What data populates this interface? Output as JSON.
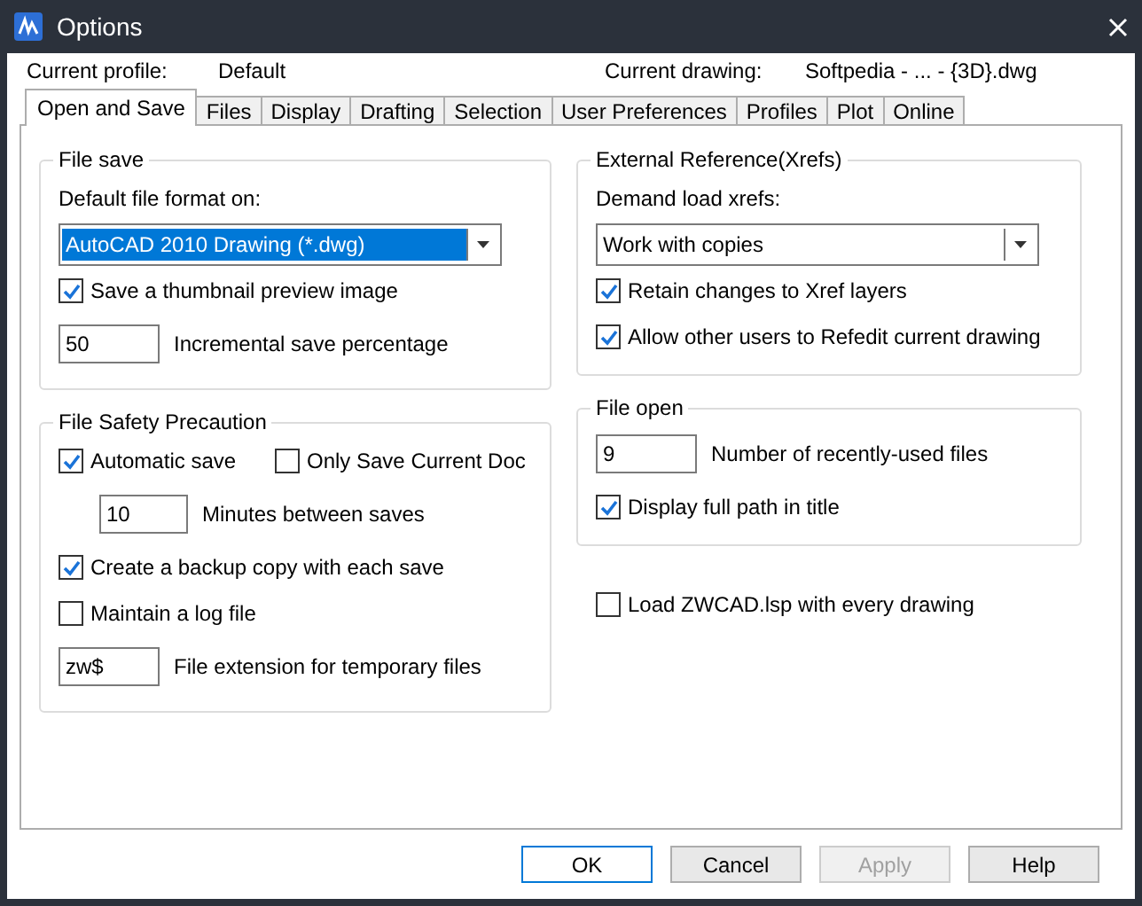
{
  "window": {
    "title": "Options"
  },
  "profile": {
    "label": "Current profile:",
    "value": "Default"
  },
  "drawing": {
    "label": "Current drawing:",
    "value": "Softpedia - ... - {3D}.dwg"
  },
  "tabs": [
    {
      "label": "Open and Save",
      "selected": true
    },
    {
      "label": "Files",
      "selected": false
    },
    {
      "label": "Display",
      "selected": false
    },
    {
      "label": "Drafting",
      "selected": false
    },
    {
      "label": "Selection",
      "selected": false
    },
    {
      "label": "User Preferences",
      "selected": false
    },
    {
      "label": "Profiles",
      "selected": false
    },
    {
      "label": "Plot",
      "selected": false
    },
    {
      "label": "Online",
      "selected": false
    }
  ],
  "columns": [
    {
      "groups": [
        {
          "title": "File save",
          "items": [
            {
              "kind": "label",
              "text": "Default file format on:"
            },
            {
              "kind": "dropdown",
              "value": "AutoCAD 2010 Drawing (*.dwg)",
              "focused": true
            },
            {
              "kind": "checkbox",
              "label": "Save a thumbnail preview image",
              "checked": true
            },
            {
              "kind": "number",
              "value": "50",
              "caption": "Incremental save percentage"
            }
          ]
        },
        {
          "title": "File Safety Precaution",
          "items": [
            {
              "kind": "checkbox_row",
              "boxes": [
                {
                  "label": "Automatic save",
                  "checked": true
                },
                {
                  "label": "Only Save Current Doc",
                  "checked": false
                }
              ]
            },
            {
              "kind": "number",
              "indent": true,
              "value": "10",
              "caption": "Minutes between saves"
            },
            {
              "kind": "checkbox",
              "label": "Create a backup copy with each save",
              "checked": true
            },
            {
              "kind": "checkbox",
              "label": "Maintain a log file",
              "checked": false
            },
            {
              "kind": "number",
              "value": "zw$",
              "caption": "File extension for temporary files"
            }
          ]
        }
      ]
    },
    {
      "groups": [
        {
          "title": "External Reference(Xrefs)",
          "items": [
            {
              "kind": "label",
              "text": "Demand load xrefs:"
            },
            {
              "kind": "dropdown",
              "value": "Work with copies",
              "focused": false
            },
            {
              "kind": "checkbox",
              "label": "Retain changes to Xref layers",
              "checked": true
            },
            {
              "kind": "checkbox",
              "label": "Allow other users to Refedit current drawing",
              "checked": true
            }
          ]
        },
        {
          "title": "File open",
          "items": [
            {
              "kind": "number",
              "value": "9",
              "caption": "Number of recently-used files"
            },
            {
              "kind": "checkbox",
              "label": "Display full path in title",
              "checked": true
            }
          ]
        }
      ],
      "extra": [
        {
          "kind": "checkbox",
          "label": "Load ZWCAD.lsp with every drawing",
          "checked": false
        }
      ]
    }
  ],
  "buttons": [
    {
      "label": "OK",
      "default": true,
      "disabled": false
    },
    {
      "label": "Cancel",
      "default": false,
      "disabled": false
    },
    {
      "label": "Apply",
      "default": false,
      "disabled": true
    },
    {
      "label": "Help",
      "default": false,
      "disabled": false
    }
  ]
}
